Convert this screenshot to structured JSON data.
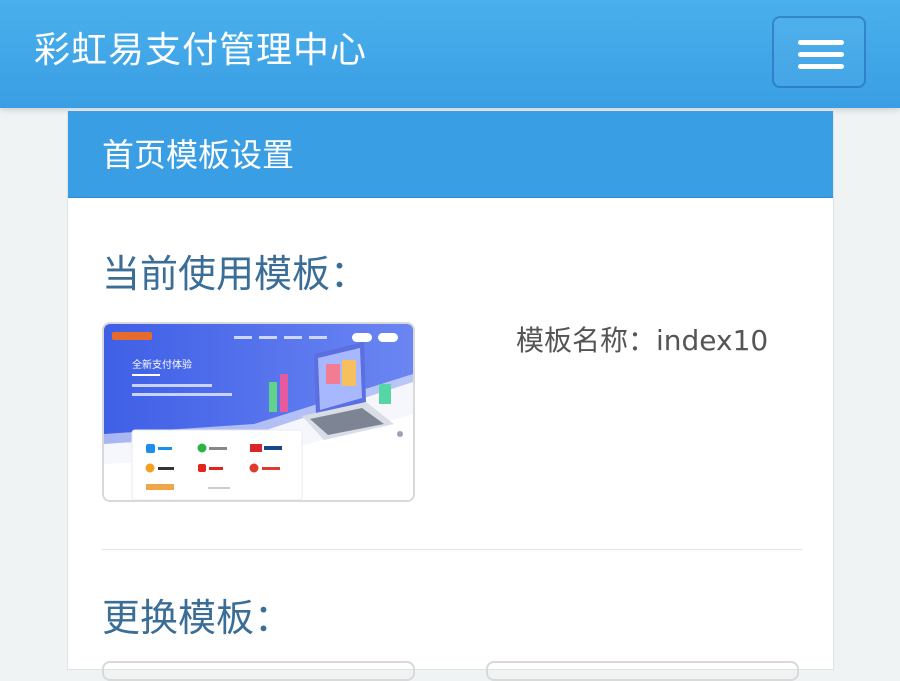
{
  "navbar": {
    "brand": "彩虹易支付管理中心",
    "menu_icon": "hamburger-menu-icon"
  },
  "panel": {
    "title": "首页模板设置",
    "current_template_heading": "当前使用模板：",
    "template_name_label": "模板名称：index10",
    "change_template_heading": "更换模板："
  },
  "preview": {
    "hero_title": "全新支付体验",
    "icons": [
      "alipay-icon",
      "wechat-pay-icon",
      "unionpay-icon",
      "qq-wallet-icon",
      "jd-pay-icon",
      "baidu-wallet-icon"
    ]
  },
  "colors": {
    "primary": "#3a9ee4",
    "heading_text": "#3b6e97"
  }
}
